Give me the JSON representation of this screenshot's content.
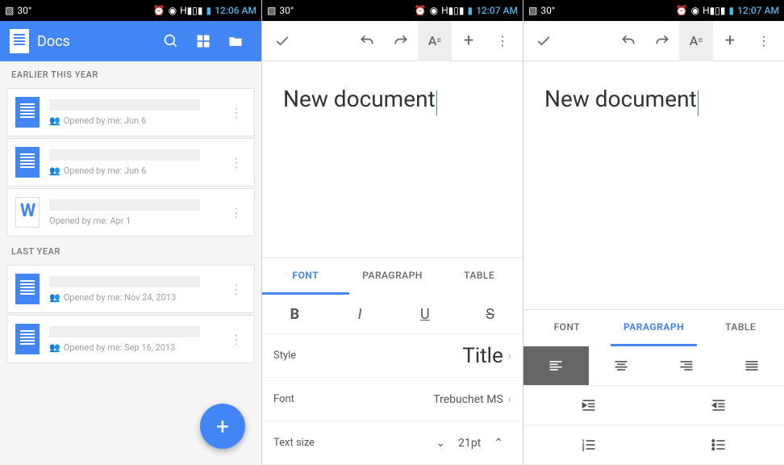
{
  "status": {
    "temp": "30°",
    "time1": "12:06 AM",
    "time2": "12:07 AM",
    "time3": "12:07 AM"
  },
  "app": {
    "title": "Docs"
  },
  "sections": {
    "earlier": "EARLIER THIS YEAR",
    "last": "LAST YEAR"
  },
  "docs": {
    "d1": "Opened by me: Jun 6",
    "d2": "Opened by me: Jun 6",
    "d3": "Opened by me: Apr 1",
    "d4": "Opened by me: Nov 24, 2013",
    "d5": "Opened by me: Sep 16, 2013"
  },
  "editor": {
    "content": "New document"
  },
  "tabs": {
    "font": "FONT",
    "paragraph": "PARAGRAPH",
    "table": "TABLE"
  },
  "settings": {
    "style_label": "Style",
    "style_val": "Title",
    "font_label": "Font",
    "font_val": "Trebuchet MS",
    "size_label": "Text size",
    "size_val": "21pt"
  }
}
